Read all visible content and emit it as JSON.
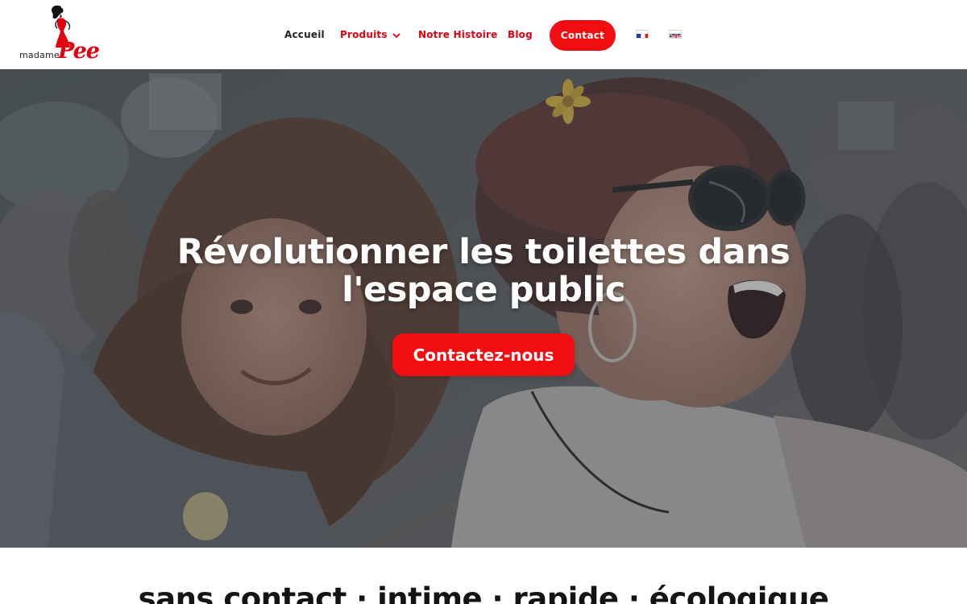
{
  "brand": {
    "logo_word_small": "madame",
    "logo_word_large": "Pee",
    "accent_color": "#f20d12",
    "icon": "woman-silhouette-icon"
  },
  "nav": {
    "home": "Accueil",
    "products": "Produits",
    "history": "Notre Histoire",
    "blog": "Blog",
    "contact": "Contact",
    "languages": [
      {
        "code": "fr",
        "icon": "french-flag-icon"
      },
      {
        "code": "en",
        "icon": "uk-flag-icon"
      }
    ]
  },
  "hero": {
    "title_line1": "Révolutionner les toilettes dans",
    "title_line2": "l'espace public",
    "cta": "Contactez-nous"
  },
  "features": {
    "tagline": "sans contact · intime · rapide · écologique"
  }
}
